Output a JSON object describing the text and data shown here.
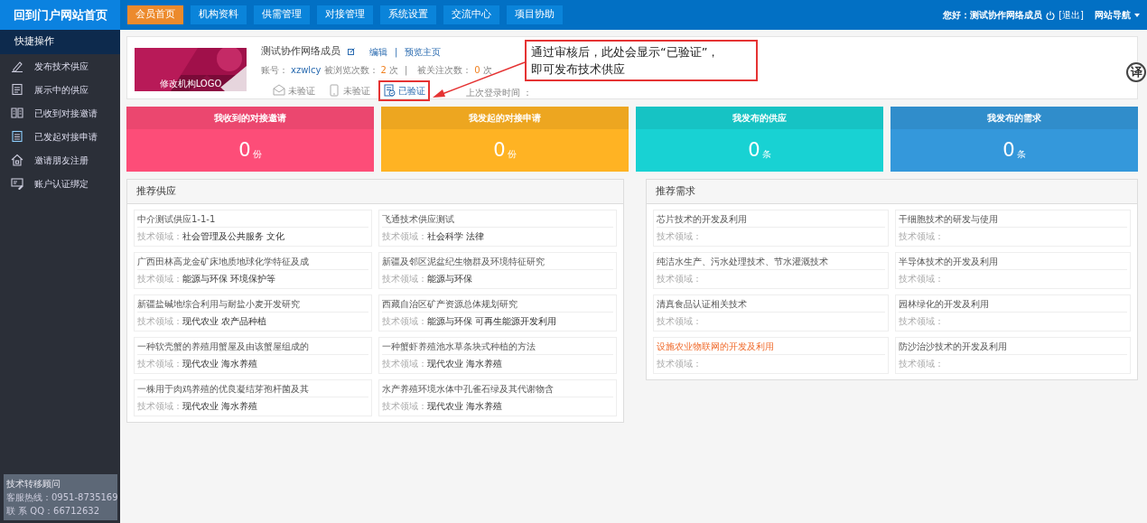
{
  "header": {
    "home_link": "回到门户网站首页",
    "nav": [
      {
        "label": "会员首页",
        "selected": true
      },
      {
        "label": "机构资料",
        "selected": false
      },
      {
        "label": "供需管理",
        "selected": false
      },
      {
        "label": "对接管理",
        "selected": false
      },
      {
        "label": "系统设置",
        "selected": false
      },
      {
        "label": "交流中心",
        "selected": false
      },
      {
        "label": "项目协助",
        "selected": false
      }
    ],
    "greeting": "您好：测试协作网络成员",
    "logout": "[退出]",
    "site_nav": "网站导航"
  },
  "sidebar": {
    "title": "快捷操作",
    "items": [
      {
        "label": "发布技术供应"
      },
      {
        "label": "展示中的供应"
      },
      {
        "label": "已收到对接邀请"
      },
      {
        "label": "已发起对接申请"
      },
      {
        "label": "邀请朋友注册"
      },
      {
        "label": "账户认证绑定"
      }
    ],
    "contact": {
      "title": "技术转移顾问",
      "lines": [
        "客服热线：0951-8735169",
        "联 系 QQ：66712632"
      ]
    }
  },
  "profile": {
    "logo_label": "修改机构LOGO",
    "name": "测试协作网络成员",
    "edit": "编辑",
    "separator": "|",
    "preview": "预览主页",
    "account_label": "账号：",
    "account": "xzwlcy",
    "views_label": "被浏览次数：",
    "views": "2",
    "views_unit": "次",
    "meta_separator": "|",
    "follows_label": "被关注次数：",
    "follows": "0",
    "follows_unit": "次",
    "badges": [
      {
        "kind": "email",
        "label": "未验证",
        "verified": false
      },
      {
        "kind": "phone",
        "label": "未验证",
        "verified": false
      },
      {
        "kind": "license",
        "label": "已验证",
        "verified": true
      }
    ],
    "last_login": "上次登录时间 ："
  },
  "annotation": {
    "lines": [
      "通过审核后，此处会显示“已验证”，",
      "即可发布技术供应"
    ]
  },
  "translate_button": "译",
  "stats": [
    {
      "title": "我收到的对接邀请",
      "value": "0",
      "unit": "份",
      "color": "#fd4d78"
    },
    {
      "title": "我发起的对接申请",
      "value": "0",
      "unit": "份",
      "color": "#ffb323"
    },
    {
      "title": "我发布的供应",
      "value": "0",
      "unit": "条",
      "color": "#18d2d3"
    },
    {
      "title": "我发布的需求",
      "value": "0",
      "unit": "条",
      "color": "#3498db"
    }
  ],
  "supply": {
    "title": "推荐供应",
    "items": [
      {
        "title": "中介测试供应1-1-1",
        "field_label": "技术领域：",
        "fields": "社会管理及公共服务 文化",
        "highlighted": false
      },
      {
        "title": "飞通技术供应测试",
        "field_label": "技术领域：",
        "fields": "社会科学 法律",
        "highlighted": false
      },
      {
        "title": "广西田林高龙金矿床地质地球化学特征及成",
        "field_label": "技术领域：",
        "fields": "能源与环保 环境保护等",
        "highlighted": false
      },
      {
        "title": "新疆及邻区泥盆纪生物群及环境特征研究",
        "field_label": "技术领域：",
        "fields": "能源与环保",
        "highlighted": false
      },
      {
        "title": "新疆盐碱地综合利用与耐盐小麦开发研究",
        "field_label": "技术领域：",
        "fields": "现代农业 农产品种植",
        "highlighted": false
      },
      {
        "title": "西藏自治区矿产资源总体规划研究",
        "field_label": "技术领域：",
        "fields": "能源与环保 可再生能源开发利用",
        "highlighted": false
      },
      {
        "title": "一种软壳蟹的养殖用蟹屋及由该蟹屋组成的",
        "field_label": "技术领域：",
        "fields": "现代农业 海水养殖",
        "highlighted": false
      },
      {
        "title": "一种蟹虾养殖池水草条块式种植的方法",
        "field_label": "技术领域：",
        "fields": "现代农业 海水养殖",
        "highlighted": false
      },
      {
        "title": "一株用于肉鸡养殖的优良凝结芽孢杆菌及其",
        "field_label": "技术领域：",
        "fields": "现代农业 海水养殖",
        "highlighted": false
      },
      {
        "title": "水产养殖环境水体中孔雀石绿及其代谢物含",
        "field_label": "技术领域：",
        "fields": "现代农业 海水养殖",
        "highlighted": false
      }
    ]
  },
  "demand": {
    "title": "推荐需求",
    "items": [
      {
        "title": "芯片技术的开发及利用",
        "field_label": "技术领域：",
        "highlighted": false
      },
      {
        "title": "干细胞技术的研发与使用",
        "field_label": "技术领域：",
        "highlighted": false
      },
      {
        "title": "纯洁水生产、污水处理技术、节水灌溉技术",
        "field_label": "技术领域：",
        "highlighted": false
      },
      {
        "title": "半导体技术的开发及利用",
        "field_label": "技术领域：",
        "highlighted": false
      },
      {
        "title": "清真食品认证相关技术",
        "field_label": "技术领域：",
        "highlighted": false
      },
      {
        "title": "园林绿化的开发及利用",
        "field_label": "技术领域：",
        "highlighted": false
      },
      {
        "title": "设施农业物联网的开发及利用",
        "field_label": "技术领域：",
        "highlighted": true
      },
      {
        "title": "防沙治沙技术的开发及利用",
        "field_label": "技术领域：",
        "highlighted": false
      }
    ]
  }
}
